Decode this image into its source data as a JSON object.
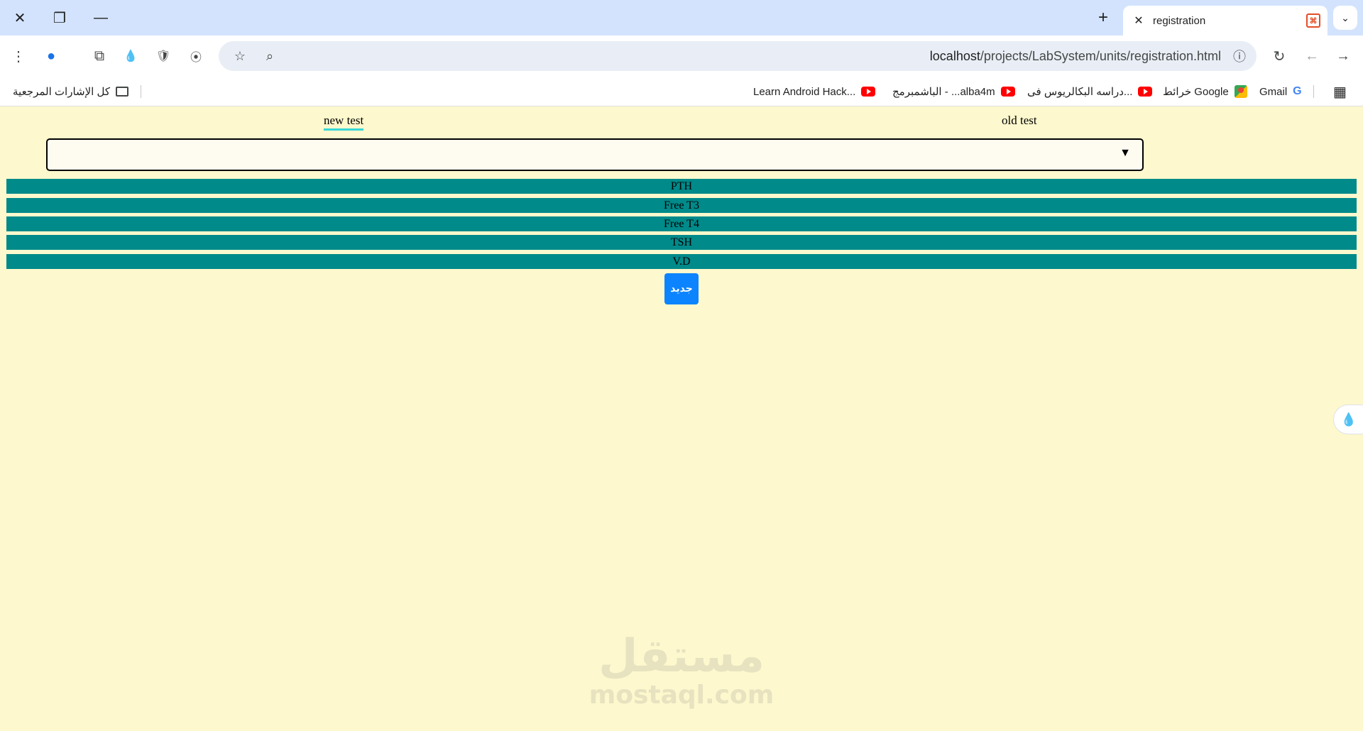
{
  "window": {
    "close_glyph": "✕",
    "restore_glyph": "❐",
    "minimize_glyph": "—"
  },
  "tab": {
    "close_glyph": "✕",
    "title": "registration",
    "favicon_glyph": "⌘",
    "new_tab_glyph": "+",
    "tab_search_glyph": "⌄"
  },
  "toolbar": {
    "menu_glyph": "⋮",
    "profile_glyph": "●",
    "extensions_glyph": "⧉",
    "ext1_glyph": "💧",
    "ext2_glyph": "🛡",
    "ext3_glyph": "⦿",
    "star_glyph": "☆",
    "zoom_glyph": "⌕",
    "info_glyph": "ⓘ",
    "reload_glyph": "↻",
    "back_glyph": "←",
    "forward_glyph": "→",
    "url_host": "localhost",
    "url_path": "/projects/LabSystem/units/registration.html"
  },
  "bookmarks": {
    "apps_glyph": "▦",
    "items": [
      {
        "label": "Gmail"
      },
      {
        "label": "خرائط Google"
      },
      {
        "label": "دراسه البكالريوس فى..."
      },
      {
        "label": "الباشمبرمج - ...alba4m"
      },
      {
        "label": "Learn Android Hack..."
      }
    ],
    "all_bookmarks": "كل الإشارات المرجعية"
  },
  "page": {
    "tabs": {
      "new_test": "new test",
      "old_test": "old test"
    },
    "select": {
      "value": "",
      "arrow_glyph": "▼"
    },
    "tests": [
      "PTH",
      "Free T3",
      "Free T4",
      "TSH",
      "V.D"
    ],
    "new_button": "جديد",
    "side_button_glyph": "💧",
    "watermark": {
      "arabic": "مستقل",
      "latin": "mostaql.com"
    }
  },
  "colors": {
    "page_bg": "#fdf8cd",
    "row_bg": "#008a8a",
    "button_bg": "#0d84ff",
    "active_tab_underline": "#36d6d6",
    "tabstrip_bg": "#d3e3fd"
  }
}
